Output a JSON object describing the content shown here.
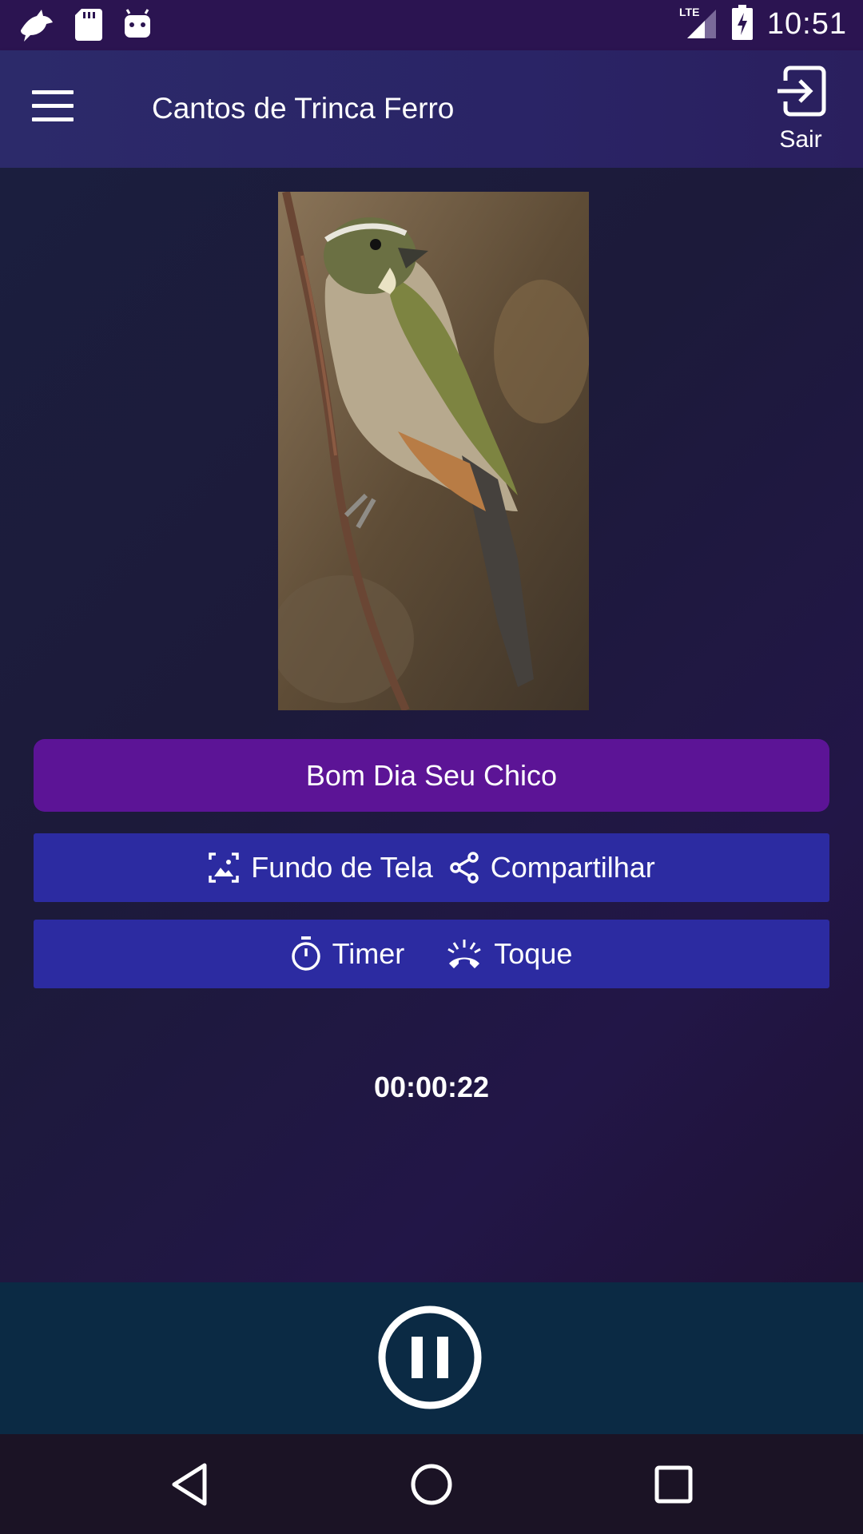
{
  "status_bar": {
    "time": "10:51",
    "network": "LTE",
    "icons": [
      "bird-app-icon",
      "sd-card-icon",
      "android-icon",
      "signal-icon",
      "battery-charging-icon"
    ]
  },
  "app_bar": {
    "title": "Cantos de Trinca Ferro",
    "exit_label": "Sair",
    "icons": [
      "menu-icon",
      "exit-icon"
    ]
  },
  "content": {
    "song_title": "Bom Dia Seu Chico",
    "wallpaper_label": "Fundo de Tela",
    "share_label": "Compartilhar",
    "timer_label": "Timer",
    "ringtone_label": "Toque",
    "icons": [
      "wallpaper-icon",
      "share-icon",
      "stopwatch-icon",
      "ringtone-icon"
    ]
  },
  "player": {
    "elapsed": "00:00:22",
    "state_icon": "pause-icon"
  },
  "nav_bar": {
    "icons": [
      "back-icon",
      "home-icon",
      "recents-icon"
    ]
  },
  "colors": {
    "status_bar": "#2b1451",
    "app_bar": "#2a2466",
    "song_button": "#5c1496",
    "action_buttons": "#2c2ba1",
    "player_bar": "#0b2a44",
    "nav_bar": "#1b1325"
  }
}
